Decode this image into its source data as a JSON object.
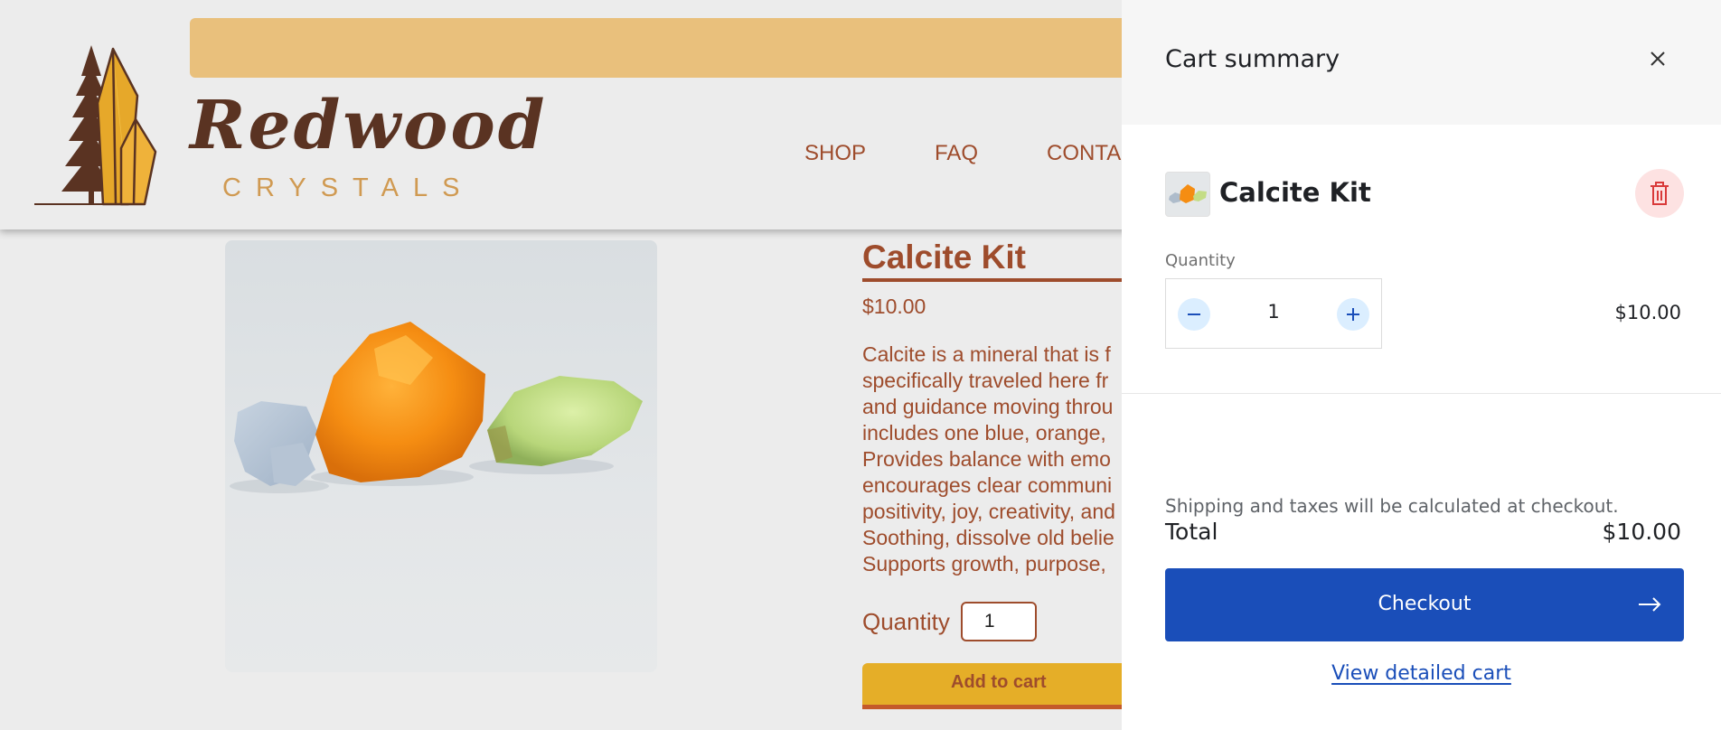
{
  "header": {
    "logo_word": "Redwood",
    "logo_sub": "CRYSTALS",
    "nav": [
      "SHOP",
      "FAQ",
      "CONTACT"
    ]
  },
  "product": {
    "title": "Calcite Kit",
    "price": "$10.00",
    "description_lines": [
      "Calcite is a mineral that is f",
      "specifically traveled here fr",
      "and guidance moving throu",
      "includes one blue, orange,",
      "Provides balance with emo",
      "encourages clear communi",
      "positivity, joy, creativity, and",
      "Soothing, dissolve old belie",
      "Supports growth, purpose,"
    ],
    "quantity_label": "Quantity",
    "quantity_value": "1",
    "add_to_cart_label": "Add to cart"
  },
  "cart": {
    "title": "Cart summary",
    "item": {
      "name": "Calcite Kit",
      "quantity_label": "Quantity",
      "quantity": "1",
      "line_price": "$10.00"
    },
    "shipping_note": "Shipping and taxes will be calculated at checkout.",
    "total_label": "Total",
    "total_value": "$10.00",
    "checkout_label": "Checkout",
    "view_cart_label": "View detailed cart"
  },
  "colors": {
    "brand_brown": "#9e4c2c",
    "announce_bar": "#e9c07c",
    "add_to_cart": "#e5ae28",
    "checkout_blue": "#1a4eb9",
    "delete_bg": "#fde2e2"
  },
  "icons": [
    "close-icon",
    "trash-icon",
    "minus-icon",
    "plus-icon",
    "arrow-right-icon"
  ]
}
